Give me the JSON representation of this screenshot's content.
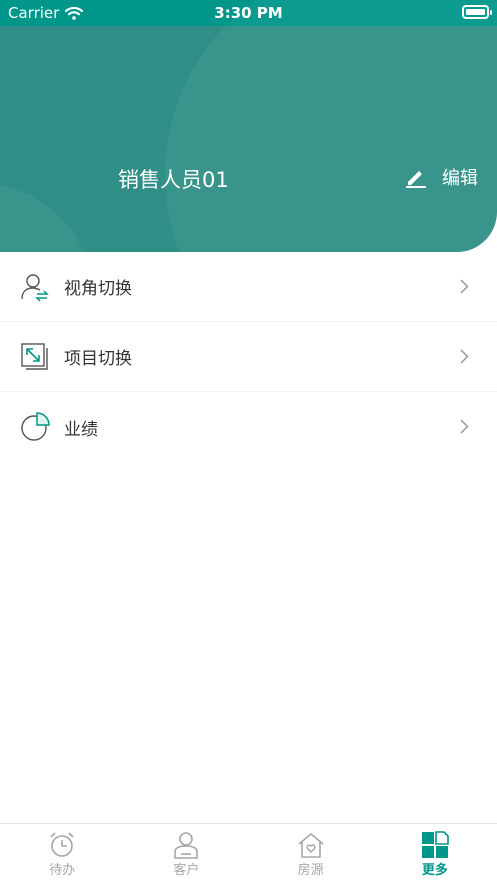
{
  "status_bar": {
    "carrier": "Carrier",
    "time": "3:30 PM"
  },
  "header": {
    "user_name": "销售人员01",
    "edit_label": "编辑"
  },
  "menu": {
    "items": [
      {
        "label": "视角切换",
        "icon": "user-switch-icon"
      },
      {
        "label": "项目切换",
        "icon": "project-switch-icon"
      },
      {
        "label": "业绩",
        "icon": "pie-chart-icon"
      }
    ]
  },
  "tabbar": {
    "tabs": [
      {
        "label": "待办",
        "icon": "alarm-clock-icon",
        "active": false
      },
      {
        "label": "客户",
        "icon": "person-icon",
        "active": false
      },
      {
        "label": "房源",
        "icon": "house-icon",
        "active": false
      },
      {
        "label": "更多",
        "icon": "grid-more-icon",
        "active": true
      }
    ]
  },
  "colors": {
    "accent": "#00968a",
    "header": "#2f8f86",
    "inactive_tab": "#a6a6a6"
  }
}
